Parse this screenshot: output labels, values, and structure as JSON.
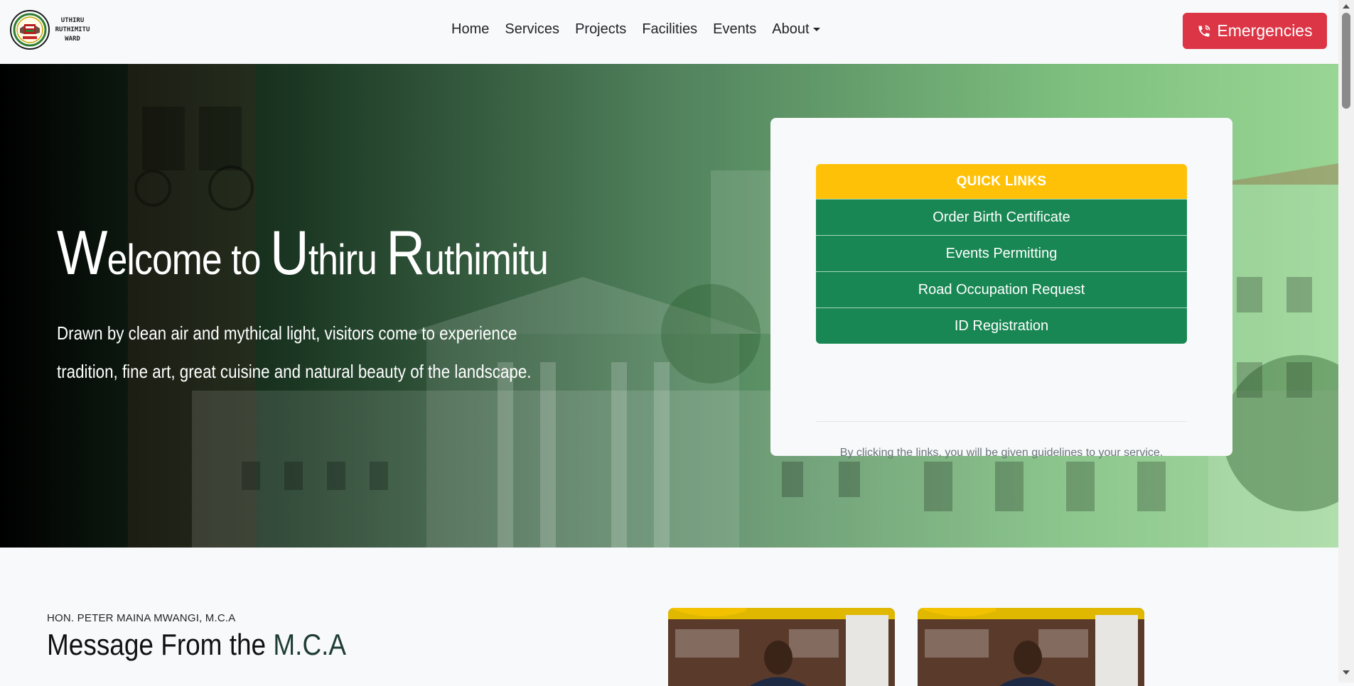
{
  "brand": {
    "line1": "UTHIRU",
    "line2": "RUTHIMITU",
    "line3": "WARD"
  },
  "nav": {
    "items": [
      {
        "label": "Home"
      },
      {
        "label": "Services"
      },
      {
        "label": "Projects"
      },
      {
        "label": "Facilities"
      },
      {
        "label": "Events"
      },
      {
        "label": "About"
      }
    ],
    "emergency_label": "Emergencies"
  },
  "hero": {
    "title": {
      "w_big": "W",
      "w_rest": "elcome to ",
      "u_big": "U",
      "u_rest": "thiru ",
      "r_big": "R",
      "r_rest": "uthimitu"
    },
    "subtitle": "Drawn by clean air and mythical light, visitors come to experience tradition, fine art, great cuisine and natural beauty of the landscape."
  },
  "quick_links": {
    "header": "QUICK LINKS",
    "items": [
      {
        "label": "Order Birth Certificate"
      },
      {
        "label": "Events Permitting"
      },
      {
        "label": "Road Occupation Request"
      },
      {
        "label": "ID Registration"
      }
    ],
    "note": "By clicking the links, you will be given guidelines to your service."
  },
  "mca": {
    "label": "HON. PETER MAINA MWANGI, M.C.A",
    "title_main": "Message From the ",
    "title_accent": "M.C.A"
  },
  "colors": {
    "emergency": "#dc3545",
    "quick_links_header": "#ffc107",
    "quick_links_item": "#198754"
  }
}
